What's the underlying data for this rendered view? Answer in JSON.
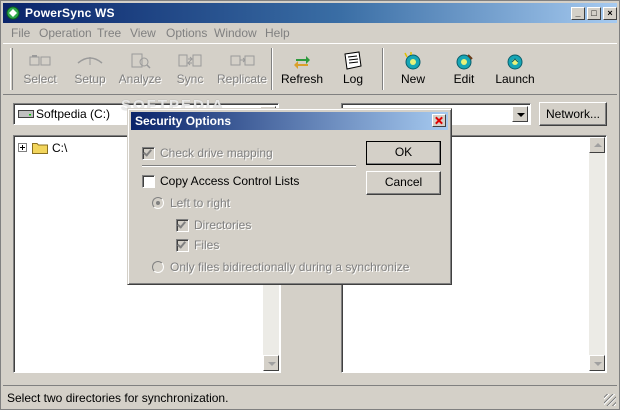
{
  "window": {
    "title": "PowerSync WS"
  },
  "menu": [
    "File",
    "Operation",
    "Tree",
    "View",
    "Options",
    "Window",
    "Help"
  ],
  "toolbar": {
    "select": "Select",
    "setup": "Setup",
    "analyze": "Analyze",
    "sync": "Sync",
    "replicate": "Replicate",
    "refresh": "Refresh",
    "log": "Log",
    "new": "New",
    "edit": "Edit",
    "launch": "Launch"
  },
  "left_drive": {
    "value": "Softpedia (C:)"
  },
  "network_button": "Network...",
  "tree": {
    "root": "C:\\"
  },
  "watermark": "SOFTPEDIA",
  "status": "Select two directories for synchronization.",
  "dialog": {
    "title": "Security Options",
    "check_drive_mapping": "Check drive mapping",
    "copy_acl": "Copy Access Control Lists",
    "left_to_right": "Left to right",
    "directories": "Directories",
    "files": "Files",
    "only_files_bidir": "Only files bidirectionally during a synchronize",
    "ok": "OK",
    "cancel": "Cancel"
  },
  "colors": {
    "titlebar": "#0a246a",
    "face": "#d4d0c8"
  }
}
